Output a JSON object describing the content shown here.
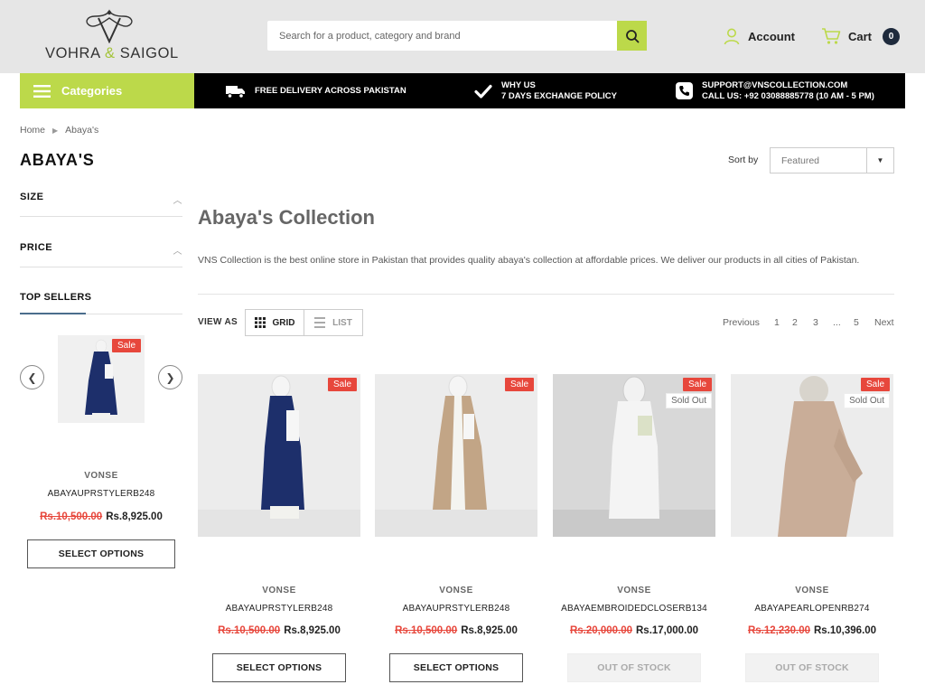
{
  "header": {
    "logo_text_left": "VOHRA",
    "logo_amp": "&",
    "logo_text_right": "SAIGOL",
    "search_placeholder": "Search for a product, category and brand",
    "account_label": "Account",
    "cart_label": "Cart",
    "cart_count": "0",
    "accent_color": "#bcd94a"
  },
  "nav": {
    "categories_label": "Categories",
    "feature_delivery": "FREE DELIVERY ACROSS PAKISTAN",
    "feature_why_line1": "WHY US",
    "feature_why_line2": "7 DAYS EXCHANGE POLICY",
    "feature_support_line1": "SUPPORT@VNSCOLLECTION.COM",
    "feature_support_line2": "CALL US: +92 03088885778 (10 AM - 5 PM)"
  },
  "breadcrumb": {
    "home": "Home",
    "current": "Abaya's"
  },
  "page_title": "ABAYA'S",
  "filters": {
    "size": "SIZE",
    "price": "PRICE"
  },
  "top_sellers": {
    "title": "TOP SELLERS",
    "item": {
      "badge": "Sale",
      "brand": "VONSE",
      "name": "ABAYAUPRSTYLERB248",
      "old_price": "Rs.10,500.00",
      "new_price": "Rs.8,925.00",
      "button": "SELECT OPTIONS"
    }
  },
  "sort": {
    "label": "Sort by",
    "value": "Featured"
  },
  "collection": {
    "title": "Abaya's Collection",
    "description": "VNS Collection is the best online store in Pakistan that provides quality abaya's collection at affordable prices. We deliver our products in all cities of Pakistan."
  },
  "view": {
    "label": "VIEW AS",
    "grid": "GRID",
    "list": "LIST"
  },
  "pagination": {
    "previous": "Previous",
    "p1": "1",
    "p2": "2",
    "p3": "3",
    "ellipsis": "...",
    "p5": "5",
    "next": "Next"
  },
  "products": [
    {
      "badge": "Sale",
      "soldout": "",
      "brand": "VONSE",
      "name": "ABAYAUPRSTYLERB248",
      "old_price": "Rs.10,500.00",
      "new_price": "Rs.8,925.00",
      "button": "SELECT OPTIONS"
    },
    {
      "badge": "Sale",
      "soldout": "",
      "brand": "VONSE",
      "name": "ABAYAUPRSTYLERB248",
      "old_price": "Rs.10,500.00",
      "new_price": "Rs.8,925.00",
      "button": "SELECT OPTIONS"
    },
    {
      "badge": "Sale",
      "soldout": "Sold Out",
      "brand": "VONSE",
      "name": "ABAYAEMBROIDEDCLOSERB134",
      "old_price": "Rs.20,000.00",
      "new_price": "Rs.17,000.00",
      "button": "OUT OF STOCK"
    },
    {
      "badge": "Sale",
      "soldout": "Sold Out",
      "brand": "VONSE",
      "name": "ABAYAPEARLOPENRB274",
      "old_price": "Rs.12,230.00",
      "new_price": "Rs.10,396.00",
      "button": "OUT OF STOCK"
    }
  ]
}
